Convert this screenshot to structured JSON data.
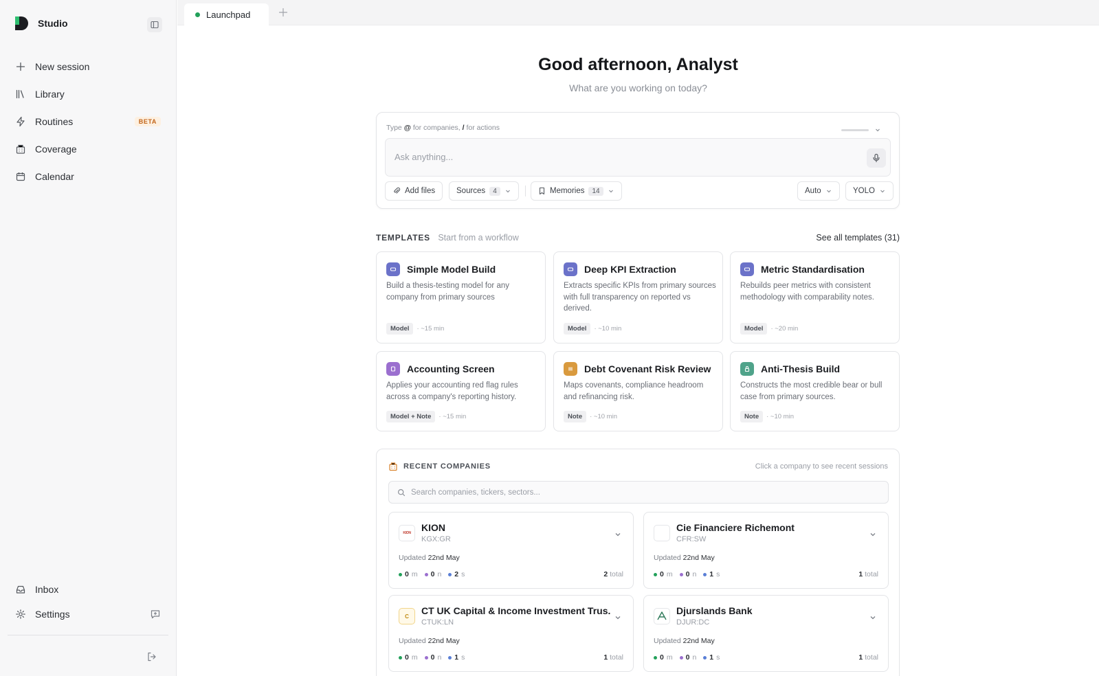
{
  "app": {
    "name": "Studio"
  },
  "sidebar": {
    "items": [
      {
        "label": "New session",
        "icon": "plus-icon"
      },
      {
        "label": "Library",
        "icon": "library-icon"
      },
      {
        "label": "Routines",
        "icon": "bolt-icon",
        "badge": "BETA"
      },
      {
        "label": "Coverage",
        "icon": "building-icon"
      },
      {
        "label": "Calendar",
        "icon": "calendar-icon"
      }
    ],
    "bottom": [
      {
        "label": "Inbox",
        "icon": "inbox-icon"
      },
      {
        "label": "Settings",
        "icon": "gear-icon"
      }
    ]
  },
  "tabs": [
    {
      "label": "Launchpad",
      "status_color": "#22a05a"
    }
  ],
  "greeting": {
    "title": "Good afternoon, Analyst",
    "subtitle": "What are you working on today?"
  },
  "composer": {
    "hint_prefix": "Type",
    "hint_at": "@",
    "hint_mid": "for companies,",
    "hint_slash": "/",
    "hint_suffix": "for actions",
    "placeholder": "Ask anything...",
    "add_files": "Add files",
    "sources_label": "Sources",
    "sources_count": "4",
    "memories_label": "Memories",
    "memories_count": "14",
    "mode": "Auto",
    "autonomy": "YOLO"
  },
  "templates": {
    "title": "TEMPLATES",
    "subtitle": "Start from a workflow",
    "see_all": "See all templates (31)",
    "cards": [
      {
        "title": "Simple Model Build",
        "desc": "Build a thesis-testing model for any company from primary sources",
        "tag": "Model",
        "time": "· ~15 min",
        "color": "#6b72c9"
      },
      {
        "title": "Deep KPI Extraction",
        "desc": "Extracts specific KPIs from primary sources with full transparency on reported vs derived.",
        "tag": "Model",
        "time": "· ~10 min",
        "color": "#6b72c9"
      },
      {
        "title": "Metric Standardisation",
        "desc": "Rebuilds peer metrics with consistent methodology with comparability notes.",
        "tag": "Model",
        "time": "· ~20 min",
        "color": "#6b72c9"
      },
      {
        "title": "Accounting Screen",
        "desc": "Applies your accounting red flag rules across a company's reporting history.",
        "tag": "Model + Note",
        "time": "· ~15 min",
        "color": "#9b6fcf"
      },
      {
        "title": "Debt Covenant Risk Review",
        "desc": "Maps covenants, compliance headroom and refinancing risk.",
        "tag": "Note",
        "time": "· ~10 min",
        "color": "#d99a3e"
      },
      {
        "title": "Anti-Thesis Build",
        "desc": "Constructs the most credible bear or bull case from primary sources.",
        "tag": "Note",
        "time": "· ~10 min",
        "color": "#4fa38a"
      }
    ]
  },
  "recent": {
    "title": "RECENT COMPANIES",
    "hint": "Click a company to see recent sessions",
    "search_placeholder": "Search companies, tickers, sectors...",
    "companies": [
      {
        "name": "KION",
        "ticker": "KGX:GR",
        "logo": "KION",
        "updated_prefix": "Updated",
        "updated": "22nd May",
        "m": "0",
        "n": "0",
        "s": "2",
        "total": "2"
      },
      {
        "name": "Cie Financiere Richemont",
        "ticker": "CFR:SW",
        "logo": "",
        "updated_prefix": "Updated",
        "updated": "22nd May",
        "m": "0",
        "n": "0",
        "s": "1",
        "total": "1"
      },
      {
        "name": "CT UK Capital & Income Investment Trus...",
        "ticker": "CTUK:LN",
        "logo": "C",
        "updated_prefix": "Updated",
        "updated": "22nd May",
        "m": "0",
        "n": "0",
        "s": "1",
        "total": "1"
      },
      {
        "name": "Djurslands Bank",
        "ticker": "DJUR:DC",
        "logo": "",
        "updated_prefix": "Updated",
        "updated": "22nd May",
        "m": "0",
        "n": "0",
        "s": "1",
        "total": "1"
      }
    ],
    "unit_m": "m",
    "unit_n": "n",
    "unit_s": "s",
    "total_label": "total"
  },
  "colors": {
    "green": "#22a05a",
    "purple": "#9b6fcf",
    "blue": "#5a7fd6",
    "accent_orange": "#d9822b"
  }
}
